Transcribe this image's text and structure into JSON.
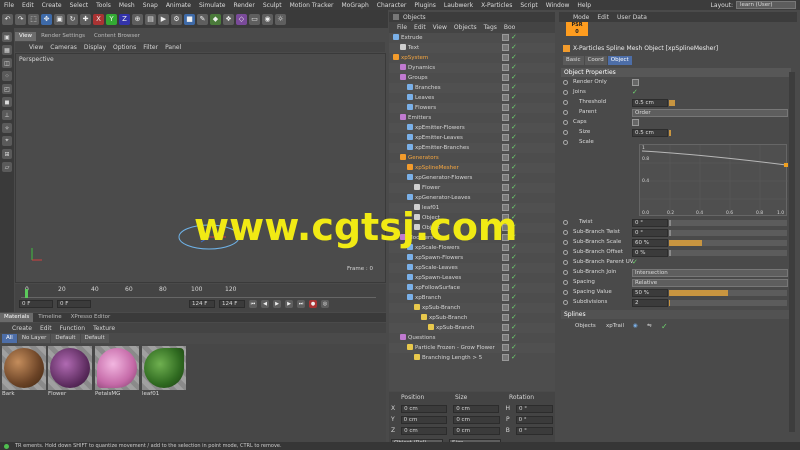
{
  "menubar": {
    "items": [
      "File",
      "Edit",
      "Create",
      "Select",
      "Tools",
      "Mesh",
      "Snap",
      "Animate",
      "Simulate",
      "Render",
      "Sculpt",
      "Motion Tracker",
      "MoGraph",
      "Character",
      "Plugins",
      "Laubwerk",
      "X-Particles",
      "Script",
      "Window",
      "Help"
    ],
    "layout_label": "Layout:",
    "layout_value": "learn (User)"
  },
  "viewport": {
    "tabs": [
      "View",
      "Render Settings",
      "Content Browser"
    ],
    "menu": [
      "View",
      "Cameras",
      "Display",
      "Options",
      "Filter",
      "Panel"
    ],
    "label": "Perspective",
    "frame_label": "Frame : 0"
  },
  "timeline": {
    "ticks": [
      "0",
      "20",
      "40",
      "60",
      "80",
      "100",
      "120"
    ],
    "start": "0 F",
    "current": "0 F",
    "end_a": "124 F",
    "end_b": "124 F"
  },
  "materials": {
    "tabs": [
      "Materials",
      "Timeline",
      "XPresso Editor"
    ],
    "menu": [
      "Create",
      "Edit",
      "Function",
      "Texture"
    ],
    "filters": [
      "All",
      "No Layer",
      "Default",
      "Default"
    ],
    "items": [
      {
        "name": "Bark",
        "color": "#8a5a36"
      },
      {
        "name": "Flower",
        "color": "#7a3a7c"
      },
      {
        "name": "PetalsMG",
        "color": "#d788c0"
      },
      {
        "name": "leaf01",
        "color": "#3f7a2c"
      }
    ]
  },
  "objects": {
    "title": "Objects",
    "menu": [
      "File",
      "Edit",
      "View",
      "Objects",
      "Tags",
      "Boo"
    ],
    "rows": [
      {
        "name": "Extrude",
        "indent": 0,
        "color": "#7ab0e8"
      },
      {
        "name": "Text",
        "indent": 1,
        "color": "#cfcfcf"
      },
      {
        "name": "xpSystem",
        "indent": 0,
        "color": "#f29b2c"
      },
      {
        "name": "Dynamics",
        "indent": 1,
        "color": "#c07ad0"
      },
      {
        "name": "Groups",
        "indent": 1,
        "color": "#c07ad0"
      },
      {
        "name": "Branches",
        "indent": 2,
        "color": "#7ab0e8"
      },
      {
        "name": "Leaves",
        "indent": 2,
        "color": "#7ab0e8"
      },
      {
        "name": "Flowers",
        "indent": 2,
        "color": "#7ab0e8"
      },
      {
        "name": "Emitters",
        "indent": 1,
        "color": "#c07ad0"
      },
      {
        "name": "xpEmitter-Flowers",
        "indent": 2,
        "color": "#7ab0e8"
      },
      {
        "name": "xpEmitter-Leaves",
        "indent": 2,
        "color": "#7ab0e8"
      },
      {
        "name": "xpEmitter-Branches",
        "indent": 2,
        "color": "#7ab0e8"
      },
      {
        "name": "Generators",
        "indent": 1,
        "color": "#f29b2c"
      },
      {
        "name": "xpSplineMesher",
        "indent": 2,
        "color": "#f29b2c"
      },
      {
        "name": "xpGenerator-Flowers",
        "indent": 2,
        "color": "#7ab0e8"
      },
      {
        "name": "Flower",
        "indent": 3,
        "color": "#cfcfcf"
      },
      {
        "name": "xpGenerator-Leaves",
        "indent": 2,
        "color": "#7ab0e8"
      },
      {
        "name": "leaf01",
        "indent": 3,
        "color": "#cfcfcf"
      },
      {
        "name": "Object",
        "indent": 3,
        "color": "#cfcfcf"
      },
      {
        "name": "Object",
        "indent": 3,
        "color": "#cfcfcf"
      },
      {
        "name": "Modifiers",
        "indent": 1,
        "color": "#c07ad0"
      },
      {
        "name": "xpScale-Flowers",
        "indent": 2,
        "color": "#7ab0e8"
      },
      {
        "name": "xpSpawn-Flowers",
        "indent": 2,
        "color": "#7ab0e8"
      },
      {
        "name": "xpScale-Leaves",
        "indent": 2,
        "color": "#7ab0e8"
      },
      {
        "name": "xpSpawn-Leaves",
        "indent": 2,
        "color": "#7ab0e8"
      },
      {
        "name": "xpFollowSurface",
        "indent": 2,
        "color": "#7ab0e8"
      },
      {
        "name": "xpBranch",
        "indent": 2,
        "color": "#7ab0e8"
      },
      {
        "name": "xpSub-Branch",
        "indent": 3,
        "color": "#e8c84c"
      },
      {
        "name": "xpSub-Branch",
        "indent": 4,
        "color": "#e8c84c"
      },
      {
        "name": "xpSub-Branch",
        "indent": 5,
        "color": "#e8c84c"
      },
      {
        "name": "Questions",
        "indent": 1,
        "color": "#c07ad0"
      },
      {
        "name": "Particle Frozen - Grow Flower",
        "indent": 2,
        "color": "#e8c84c"
      },
      {
        "name": "Branching Length > 5",
        "indent": 3,
        "color": "#e8c84c"
      }
    ]
  },
  "coords": {
    "headers": [
      "Position",
      "Size",
      "Rotation"
    ],
    "rows": [
      {
        "axis": "X",
        "pos": "0 cm",
        "size": "0 cm",
        "rot": "H",
        "rotval": "0 °"
      },
      {
        "axis": "Y",
        "pos": "0 cm",
        "size": "0 cm",
        "rot": "P",
        "rotval": "0 °"
      },
      {
        "axis": "Z",
        "pos": "0 cm",
        "size": "0 cm",
        "rot": "B",
        "rotval": "0 °"
      }
    ],
    "mode_a": "Object (Rel)",
    "mode_b": "Size"
  },
  "attributes": {
    "menu": [
      "Mode",
      "Edit",
      "User Data"
    ],
    "psr": "PSR",
    "psr_value": "0",
    "title": "X-Particles Spline Mesh Object [xpSplineMesher]",
    "tabs": [
      "Basic",
      "Coord",
      "Object"
    ],
    "section_object": "Object Properties",
    "render_only": "Render Only",
    "joins": "Joins",
    "threshold_label": "Threshold",
    "threshold_value": "0.5 cm",
    "parent_label": "Parent",
    "parent_value": "Order",
    "caps": "Caps",
    "size_label": "Size",
    "size_value": "0.5 cm",
    "scale_label": "Scale",
    "graph_y": [
      "1",
      "0.8",
      "0.4"
    ],
    "graph_x": [
      "0.0",
      "0.2",
      "0.4",
      "0.6",
      "0.8",
      "1.0"
    ],
    "twist_label": "Twist",
    "twist_value": "0 °",
    "sbt_label": "Sub-Branch Twist",
    "sbt_value": "0 °",
    "sbs_label": "Sub-Branch Scale",
    "sbs_value": "60 %",
    "sbo_label": "Sub-Branch Offset",
    "sbo_value": "0 %",
    "sbp_label": "Sub-Branch Parent UV",
    "sbj_label": "Sub-Branch Join",
    "sbj_value": "Intersection",
    "spacing_label": "Spacing",
    "spacing_value": "Relative",
    "spv_label": "Spacing Value",
    "spv_value": "50 %",
    "subdiv_label": "Subdivisions",
    "subdiv_value": "2",
    "section_splines": "Splines",
    "spl_objects_label": "Objects",
    "spl_object": "xpTrail"
  },
  "status": "TR  ements. Hold down SHIFT to quantize movement / add to the selection in point mode, CTRL to remove.",
  "watermark": "www.cgtsj.com"
}
